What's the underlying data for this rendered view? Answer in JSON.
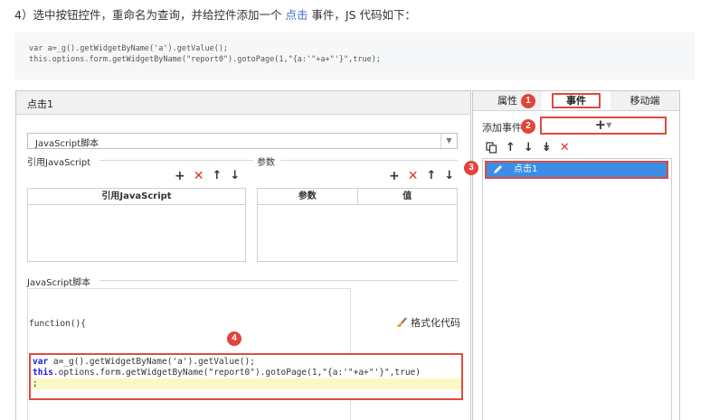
{
  "step_title": {
    "prefix": "4）选中按钮控件，重命名为查询，并给控件添加一个 ",
    "link": "点击",
    "suffix": " 事件，JS 代码如下："
  },
  "snippet": {
    "line1": "var a=_g().getWidgetByName('a').getValue();",
    "line2": "this.options.form.getWidgetByName(\"report0\").gotoPage(1,\"{a:'\"+a+\"'}\",true);"
  },
  "dialog": {
    "title": "点击1",
    "script_type": "JavaScript脚本",
    "ref_js_label": "引用JavaScript",
    "params_label": "参数",
    "ref_js_col": "引用JavaScript",
    "param_col": "参数",
    "value_col": "值",
    "script_label": "JavaScript脚本",
    "function_head": "function(){",
    "format_label": "格式化代码",
    "code": {
      "line1_kw": "var",
      "line1_rest": " a=_g().getWidgetByName('a').getValue();",
      "line2_kw": "this",
      "line2_rest": ".options.form.getWidgetByName(\"report0\").gotoPage(1,\"{a:'\"+a+\"'}\",true)",
      "line3": ";"
    }
  },
  "right_panel": {
    "tabs": [
      "属性",
      "事件",
      "移动端"
    ],
    "add_event_label": "添加事件",
    "event_item": "点击1"
  },
  "badges": [
    "1",
    "2",
    "3",
    "4"
  ],
  "colors": {
    "highlight_red": "#e04a3f",
    "selected_blue": "#3a8ee6",
    "link_blue": "#3b6fd6"
  }
}
